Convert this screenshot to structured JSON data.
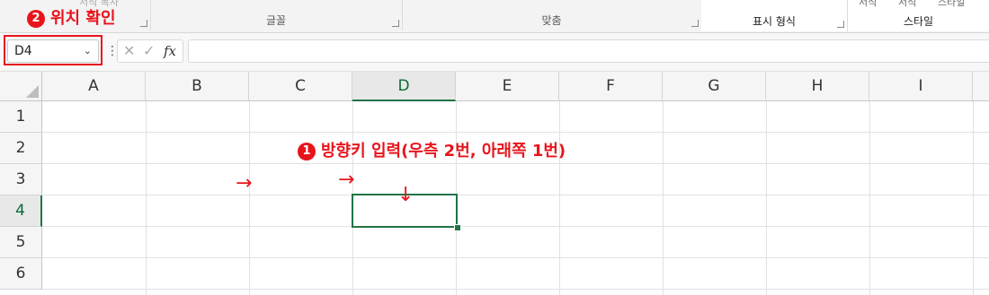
{
  "ribbon": {
    "clipboard_faded": "서식 복사",
    "font_group": "글꼴",
    "align_group": "맞춤",
    "number_group": "표시 형식",
    "styles_group": "스타일",
    "styles_faded_1": "서식",
    "styles_faded_2": "서식",
    "styles_faded_3": "스타일"
  },
  "formula_bar": {
    "name_box_value": "D4",
    "cancel_symbol": "✕",
    "enter_symbol": "✓",
    "fx_symbol": "fx",
    "formula_value": ""
  },
  "grid": {
    "columns": [
      "A",
      "B",
      "C",
      "D",
      "E",
      "F",
      "G",
      "H",
      "I"
    ],
    "rows": [
      "1",
      "2",
      "3",
      "4",
      "5",
      "6"
    ],
    "selected_cell": "D4"
  },
  "annotations": {
    "step2_num": "2",
    "step2_text": "위치 확인",
    "step1_num": "1",
    "step1_text": "방향키 입력(우측 2번, 아래쪽 1번)",
    "arrow_right_1": "→",
    "arrow_right_2": "→",
    "arrow_down": "↓",
    "accent_color": "#e8141c",
    "selection_color": "#217346"
  }
}
